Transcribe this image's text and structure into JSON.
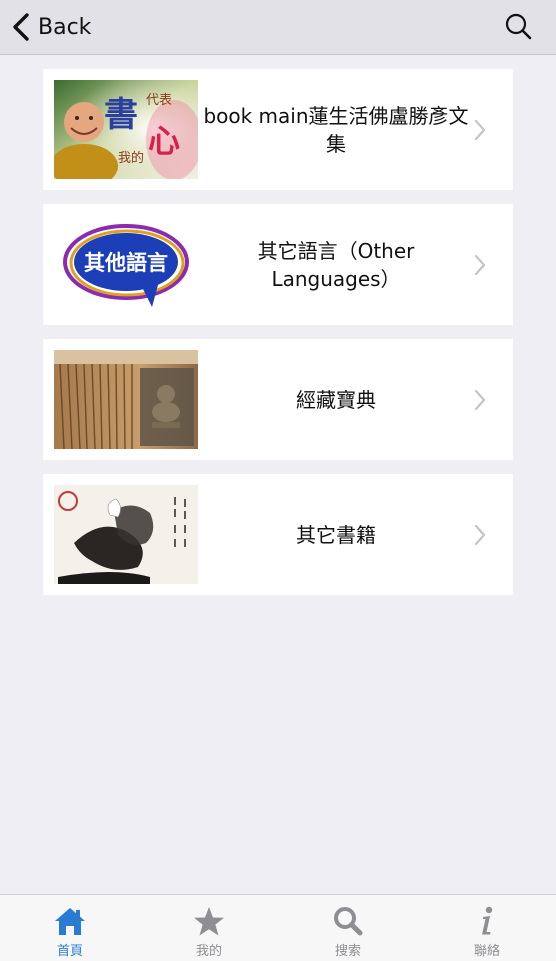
{
  "nav": {
    "back_label": "Back",
    "search_icon": "search-icon"
  },
  "items": [
    {
      "title": "book main蓮生活佛盧勝彥文集",
      "thumb_text": "書",
      "thumb_text2": "代表",
      "thumb_text3": "我的",
      "thumb_text4": "心"
    },
    {
      "title": "其它語言（Other Languages）",
      "thumb_text": "其他語言"
    },
    {
      "title": "經藏寶典"
    },
    {
      "title": "其它書籍"
    }
  ],
  "tabs": [
    {
      "label": "首頁",
      "icon": "home-icon",
      "active": true
    },
    {
      "label": "我的",
      "icon": "star-icon",
      "active": false
    },
    {
      "label": "搜索",
      "icon": "search-icon",
      "active": false
    },
    {
      "label": "聯絡",
      "icon": "info-icon",
      "active": false
    }
  ],
  "colors": {
    "accent": "#2a7bd4",
    "background": "#efeef4",
    "navbar": "#e3e1e8"
  }
}
